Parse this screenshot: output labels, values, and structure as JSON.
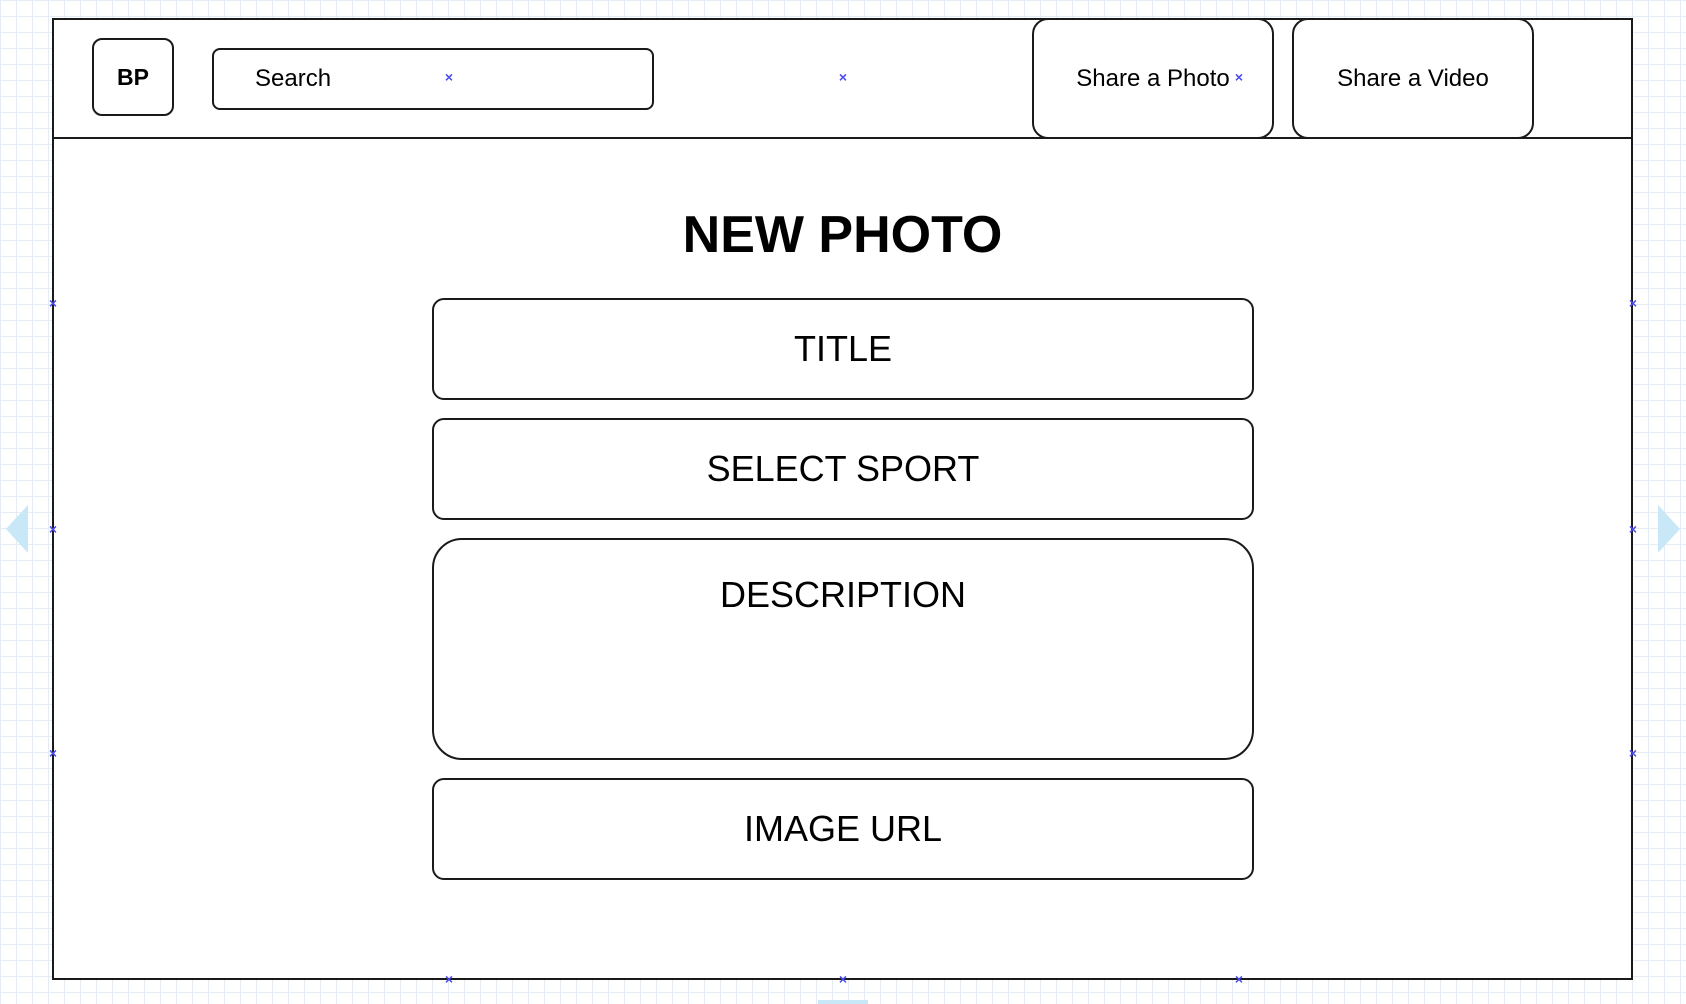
{
  "header": {
    "logo_text": "BP",
    "search_placeholder": "Search",
    "nav": [
      {
        "label": "Share a Photo"
      },
      {
        "label": "Share a Video"
      }
    ]
  },
  "form": {
    "heading": "NEW PHOTO",
    "fields": [
      {
        "label": "TITLE"
      },
      {
        "label": "SELECT SPORT"
      },
      {
        "label": "DESCRIPTION"
      },
      {
        "label": "IMAGE URL"
      }
    ]
  },
  "markers": {
    "glyph": "×",
    "color": "#4a4af0"
  },
  "colors": {
    "stroke": "#1a1a1a",
    "accent": "#c8e8f8"
  }
}
